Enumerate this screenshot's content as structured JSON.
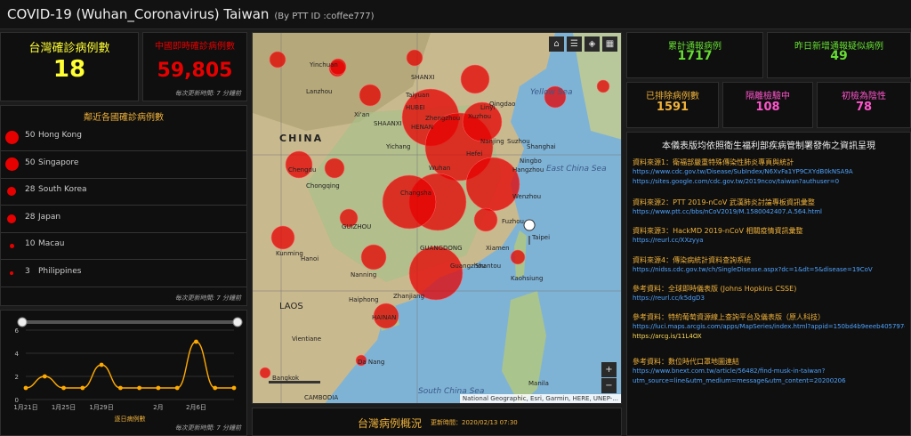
{
  "header": {
    "title": "COVID-19 (Wuhan_Coronavirus) Taiwan",
    "subtitle": "(By PTT ID :coffee777)"
  },
  "taiwan_confirmed": {
    "label": "台灣確診病例數",
    "value": "18",
    "color": "#ffff33"
  },
  "china_confirmed": {
    "label": "中國即時確診病例數",
    "value": "59,805",
    "color": "#e60000"
  },
  "update_note": "每次更新時間: 7 分鐘前",
  "neighbors": {
    "title": "鄰近各國確診病例數",
    "rows": [
      {
        "count": "50",
        "name": "Hong Kong"
      },
      {
        "count": "50",
        "name": "Singapore"
      },
      {
        "count": "28",
        "name": "South Korea"
      },
      {
        "count": "28",
        "name": "Japan"
      },
      {
        "count": "10",
        "name": "Macau"
      },
      {
        "count": "3",
        "name": "Philippines"
      }
    ]
  },
  "chart_data": {
    "type": "line",
    "title": "",
    "xlabel": "逐日病例數",
    "ylabel": "",
    "x_ticks": [
      "1月21日",
      "1月25日",
      "1月29日",
      "2月",
      "2月6日"
    ],
    "y_ticks": [
      "0",
      "2",
      "4",
      "6"
    ],
    "ylim": [
      0,
      6
    ],
    "series": [
      {
        "name": "",
        "color": "#ffaa00",
        "values": [
          1,
          2,
          1,
          1,
          3,
          1,
          1,
          1,
          1,
          5,
          1,
          1
        ]
      }
    ],
    "grid": true
  },
  "map": {
    "attribution": "National Geographic, Esri, Garmin, HERE, UNEP-...",
    "labels": [
      "CHINA",
      "HUBEI",
      "HENAN",
      "SHANXI",
      "SHAANXI",
      "Wuhan",
      "Shanghai",
      "Hangzhou",
      "Fuzhou",
      "Taipei",
      "Kaohsiung",
      "Guangzhou",
      "HAINAN",
      "Hanoi",
      "LAOS",
      "Bangkok",
      "Manila",
      "Nanning",
      "Chengdu",
      "Chongqing",
      "GUANGDONG",
      "Qingdao",
      "Nanjing",
      "Changsha",
      "Xiamen",
      "Taiyuan",
      "Yinchuan",
      "Lanzhou",
      "Xi'an",
      "Kunming",
      "Da Nang",
      "Vientiane",
      "CAMBODIA",
      "Haiphong",
      "Zhanjiang",
      "GUIZHOU",
      "Ningbo",
      "Wenzhou",
      "Shantou",
      "Hefei",
      "Zhengzhou",
      "Suzhou",
      "Xuzhou",
      "Linyi",
      "Yichang"
    ],
    "seas": [
      "Yellow Sea",
      "East China Sea",
      "South China Sea"
    ],
    "zoom_in": "+",
    "zoom_out": "−"
  },
  "bottom": {
    "title": "台灣病例概況",
    "updated": "更新時間：2020/02/13 07:30"
  },
  "stats": [
    {
      "label": "累計通報病例",
      "value": "1717",
      "color": "#66dd33"
    },
    {
      "label": "昨日新增通報疑似病例",
      "value": "49",
      "color": "#66dd33"
    },
    {
      "label": "已排除病例數",
      "value": "1591",
      "color": "#f0b23a"
    },
    {
      "label": "隔離檢驗中",
      "value": "108",
      "color": "#ff55cc"
    },
    {
      "label": "初檢為陰性",
      "value": "78",
      "color": "#ff55cc"
    }
  ],
  "sources": {
    "heading": "本儀表版均依照衛生福利部疾病管制署發佈之資訊呈現",
    "items": [
      {
        "label": "資料來源1：衛福部嚴重特殊傳染性肺炎專頁與統計",
        "links": [
          "https://www.cdc.gov.tw/Disease/SubIndex/N6XvFa1YP9CXYdB0kNSA9A",
          "https://sites.google.com/cdc.gov.tw/2019ncov/taiwan?authuser=0"
        ]
      },
      {
        "label": "資料來源2：PTT 2019-nCoV 武漢肺炎討論專板資訊彙整",
        "links": [
          "https://www.ptt.cc/bbs/nCoV2019/M.1580042407.A.564.html"
        ]
      },
      {
        "label": "資料來源3：HackMD 2019-nCoV 相關疫情資訊彙整",
        "links": [
          "https://reurl.cc/XXzyya"
        ]
      },
      {
        "label": "資料來源4：傳染病統計資料查詢系統",
        "links": [
          "https://nidss.cdc.gov.tw/ch/SingleDisease.aspx?dc=1&dt=5&disease=19CoV"
        ]
      },
      {
        "label": "參考資料：全球即時儀表版 (Johns Hopkins CSSE)",
        "links": [
          "https://reurl.cc/k5dgD3"
        ]
      },
      {
        "label": "參考資料：特約葡萄資源線上查詢平台及儀表版（原人科技）",
        "links": [
          "https://luci.maps.arcgis.com/apps/MapSeries/index.html?appid=150bd4b9eeeb405797c79b63b0c00081",
          "https://arcg.is/11L4OX"
        ]
      },
      {
        "label": "參考資料：數位時代口罩地圖連結",
        "links": [
          "https://www.bnext.com.tw/article/56482/find-musk-in-taiwan?",
          "utm_source=line&utm_medium=message&utm_content=20200206"
        ]
      }
    ]
  }
}
